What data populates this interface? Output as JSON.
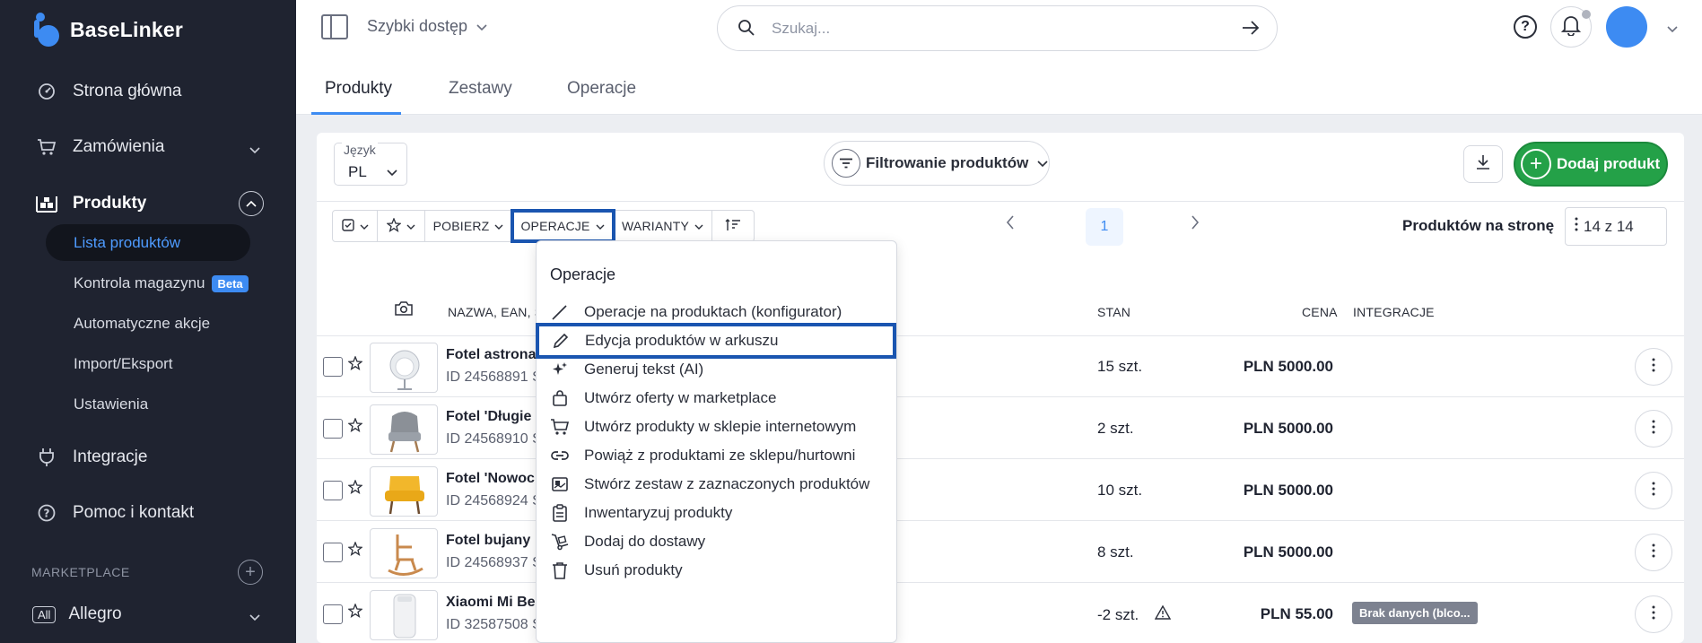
{
  "app": {
    "brand": "BaseLinker",
    "accent": "#3d8bf2",
    "sidebar_bg": "#1f2330",
    "success": "#24a148"
  },
  "sidebar": {
    "items": [
      {
        "label": "Strona główna",
        "icon": "dashboard-icon"
      },
      {
        "label": "Zamówienia",
        "icon": "cart-icon"
      },
      {
        "label": "Produkty",
        "icon": "warehouse-icon"
      },
      {
        "label": "Integracje",
        "icon": "plug-icon"
      },
      {
        "label": "Pomoc i kontakt",
        "icon": "help-icon"
      }
    ],
    "products_sub": [
      {
        "label": "Lista produktów"
      },
      {
        "label": "Kontrola magazynu",
        "badge": "Beta"
      },
      {
        "label": "Automatyczne akcje"
      },
      {
        "label": "Import/Eksport"
      },
      {
        "label": "Ustawienia"
      }
    ],
    "marketplace_label": "MARKETPLACE",
    "allegro": {
      "badge": "All",
      "label": "Allegro"
    }
  },
  "topbar": {
    "quick_access": "Szybki dostęp",
    "search_placeholder": "Szukaj..."
  },
  "tabs": [
    "Produkty",
    "Zestawy",
    "Operacje"
  ],
  "toolbar": {
    "language_label": "Język",
    "language_value": "PL",
    "filter_label": "Filtrowanie produktów",
    "add_product": "Dodaj produkt",
    "download_label": "POBIERZ",
    "operations_label": "OPERACJE",
    "variants_label": "WARIANTY",
    "page_number": "1",
    "per_page_label": "Produktów na stronę",
    "per_page_value": "14 z 14"
  },
  "table": {
    "headers": {
      "name": "NAZWA, EAN, S",
      "stock": "STAN",
      "price": "CENA",
      "integrations": "INTEGRACJE"
    },
    "rows": [
      {
        "name": "Fotel astrona",
        "sub": "ID 24568891 S",
        "stock": "15 szt.",
        "price": "PLN 5000.00",
        "integration": "",
        "warn": false
      },
      {
        "name": "Fotel 'Długie",
        "sub": "ID 24568910 S",
        "stock": "2 szt.",
        "price": "PLN 5000.00",
        "integration": "",
        "warn": false
      },
      {
        "name": "Fotel 'Nowoc",
        "sub": "ID 24568924 S",
        "stock": "10 szt.",
        "price": "PLN 5000.00",
        "integration": "",
        "warn": false
      },
      {
        "name": "Fotel bujany",
        "sub": "ID 24568937 S",
        "stock": "8 szt.",
        "price": "PLN 5000.00",
        "integration": "",
        "warn": false
      },
      {
        "name": "Xiaomi Mi Be",
        "sub": "ID 32587508 S",
        "stock": "-2 szt.",
        "price": "PLN 55.00",
        "integration": "Brak danych (blco...",
        "warn": true
      }
    ]
  },
  "menu": {
    "title": "Operacje",
    "items": [
      {
        "label": "Operacje na produktach (konfigurator)",
        "icon": "pencil-icon"
      },
      {
        "label": "Edycja produktów w arkuszu",
        "icon": "edit-pencil-icon"
      },
      {
        "label": "Generuj tekst (AI)",
        "icon": "sparkles-icon"
      },
      {
        "label": "Utwórz oferty w marketplace",
        "icon": "shopping-bag-icon"
      },
      {
        "label": "Utwórz produkty w sklepie internetowym",
        "icon": "cart-icon"
      },
      {
        "label": "Powiąż z produktami ze sklepu/hurtowni",
        "icon": "link-icon"
      },
      {
        "label": "Stwórz zestaw z zaznaczonych produktów",
        "icon": "bundle-icon"
      },
      {
        "label": "Inwentaryzuj produkty",
        "icon": "clipboard-icon"
      },
      {
        "label": "Dodaj do dostawy",
        "icon": "hand-truck-icon"
      },
      {
        "label": "Usuń produkty",
        "icon": "trash-icon"
      }
    ]
  }
}
